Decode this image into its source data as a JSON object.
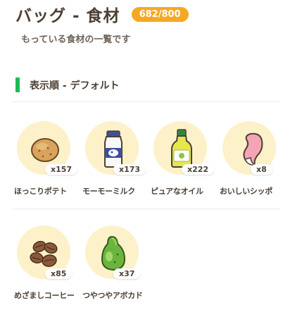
{
  "header": {
    "title": "バッグ - 食材",
    "count": "682/800",
    "subtitle": "もっている食材の一覧です"
  },
  "sort": {
    "label": "表示順 - デフォルト"
  },
  "items": [
    {
      "name": "ほっこりポテト",
      "qty": "x157",
      "icon": "potato-icon"
    },
    {
      "name": "モーモーミルク",
      "qty": "x173",
      "icon": "milk-bottle-icon"
    },
    {
      "name": "ピュアなオイル",
      "qty": "x222",
      "icon": "oil-bottle-icon"
    },
    {
      "name": "おいしいシッポ",
      "qty": "x8",
      "icon": "tail-icon"
    },
    {
      "name": "めざましコーヒー",
      "qty": "x85",
      "icon": "coffee-beans-icon"
    },
    {
      "name": "つやつやアボカド",
      "qty": "x37",
      "icon": "avocado-icon"
    }
  ],
  "colors": {
    "badge": "#f6a823",
    "sort_marker": "#1fb954",
    "item_circle": "#fdf1c9"
  }
}
